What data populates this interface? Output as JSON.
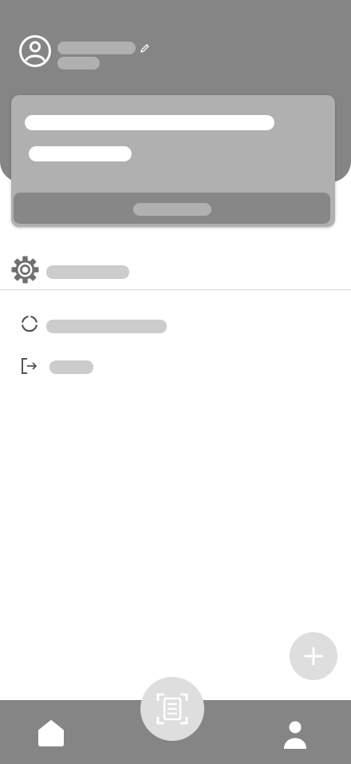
{
  "header": {
    "user_name": "",
    "user_subtitle": "",
    "colors": {
      "header_bg": "#858585",
      "placeholder": "#b0b0b0"
    },
    "icons": {
      "avatar": "user-circle-icon",
      "edit": "pencil-icon"
    }
  },
  "card": {
    "line1": "",
    "line2": "",
    "button_label": ""
  },
  "settings": {
    "label": "",
    "icon": "gear-icon"
  },
  "menu": {
    "items": [
      {
        "label": "",
        "icon": "progress-icon"
      },
      {
        "label": "",
        "icon": "logout-icon"
      }
    ]
  },
  "fab": {
    "icon": "plus-icon"
  },
  "bottom_nav": {
    "items": [
      {
        "icon": "home-icon"
      },
      {
        "icon": "scan-document-icon"
      },
      {
        "icon": "person-icon"
      }
    ]
  }
}
